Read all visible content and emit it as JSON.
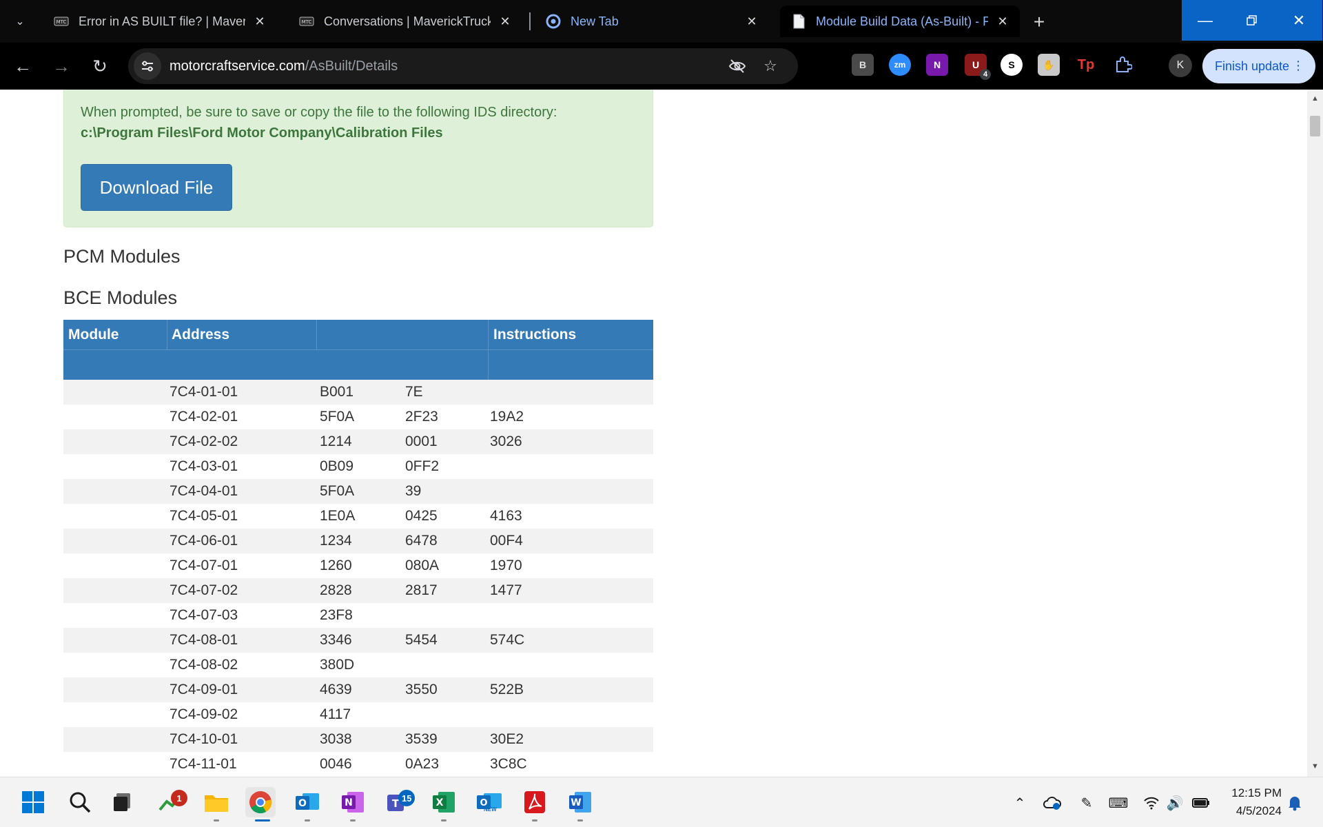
{
  "browser": {
    "tabs": [
      {
        "title": "Error in AS BUILT file? | Maveric",
        "active": false
      },
      {
        "title": "Conversations | MaverickTruckC",
        "active": false
      },
      {
        "title": "New Tab",
        "active": false
      },
      {
        "title": "Module Build Data (As-Built) - F",
        "active": true
      }
    ],
    "url_host": "motorcraftservice.com",
    "url_path": "/AsBuilt/Details",
    "profile_initial": "K",
    "finish_update_label": "Finish update",
    "extension_badge": "4"
  },
  "page": {
    "alert_text": "When prompted, be sure to save or copy the file to the following IDS directory:",
    "alert_path": "c:\\Program Files\\Ford Motor Company\\Calibration Files",
    "download_label": "Download File",
    "pcm_heading": "PCM Modules",
    "bce_heading": "BCE Modules",
    "table": {
      "headers": [
        "Module",
        "Address",
        "",
        "Instructions"
      ],
      "rows": [
        {
          "address": "7C4-01-01",
          "c1": "B001",
          "c2": "7E",
          "c3": ""
        },
        {
          "address": "7C4-02-01",
          "c1": "5F0A",
          "c2": "2F23",
          "c3": "19A2"
        },
        {
          "address": "7C4-02-02",
          "c1": "1214",
          "c2": "0001",
          "c3": "3026"
        },
        {
          "address": "7C4-03-01",
          "c1": "0B09",
          "c2": "0FF2",
          "c3": ""
        },
        {
          "address": "7C4-04-01",
          "c1": "5F0A",
          "c2": "39",
          "c3": ""
        },
        {
          "address": "7C4-05-01",
          "c1": "1E0A",
          "c2": "0425",
          "c3": "4163"
        },
        {
          "address": "7C4-06-01",
          "c1": "1234",
          "c2": "6478",
          "c3": "00F4"
        },
        {
          "address": "7C4-07-01",
          "c1": "1260",
          "c2": "080A",
          "c3": "1970"
        },
        {
          "address": "7C4-07-02",
          "c1": "2828",
          "c2": "2817",
          "c3": "1477"
        },
        {
          "address": "7C4-07-03",
          "c1": "23F8",
          "c2": "",
          "c3": ""
        },
        {
          "address": "7C4-08-01",
          "c1": "3346",
          "c2": "5454",
          "c3": "574C"
        },
        {
          "address": "7C4-08-02",
          "c1": "380D",
          "c2": "",
          "c3": ""
        },
        {
          "address": "7C4-09-01",
          "c1": "4639",
          "c2": "3550",
          "c3": "522B"
        },
        {
          "address": "7C4-09-02",
          "c1": "4117",
          "c2": "",
          "c3": ""
        },
        {
          "address": "7C4-10-01",
          "c1": "3038",
          "c2": "3539",
          "c3": "30E2"
        },
        {
          "address": "7C4-11-01",
          "c1": "0046",
          "c2": "0A23",
          "c3": "3C8C"
        }
      ]
    }
  },
  "taskbar": {
    "badge_stocks": "1",
    "badge_teams": "15",
    "outlook_new_label": "NEW",
    "time": "12:15 PM",
    "date": "4/5/2024"
  },
  "colors": {
    "accent_blue": "#337ab7",
    "alert_green_bg": "#dff0d8",
    "alert_green_text": "#3c763d",
    "window_control_blue": "#0a64c6"
  }
}
